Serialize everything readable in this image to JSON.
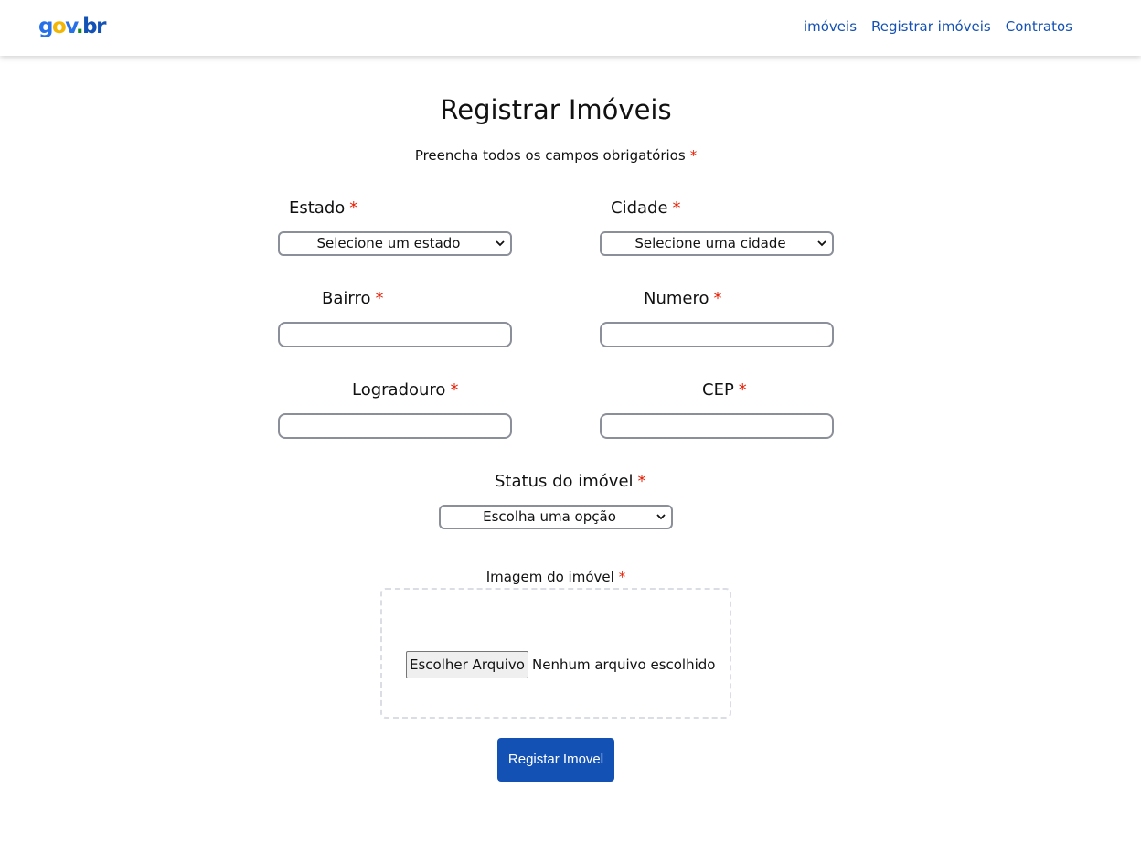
{
  "header": {
    "logo": {
      "g": "g",
      "o": "o",
      "v": "v",
      "dot": ".",
      "br": "br"
    },
    "nav": [
      {
        "label": "imóveis"
      },
      {
        "label": "Registrar imóveis"
      },
      {
        "label": "Contratos"
      }
    ]
  },
  "form": {
    "title": "Registrar Imóveis",
    "subtitle": "Preencha todos os campos obrigatórios",
    "required_mark": "*",
    "estado": {
      "label": "Estado",
      "selected": "Selecione um estado"
    },
    "cidade": {
      "label": "Cidade",
      "selected": "Selecione uma cidade"
    },
    "bairro": {
      "label": "Bairro",
      "value": ""
    },
    "numero": {
      "label": "Numero",
      "value": ""
    },
    "logradouro": {
      "label": "Logradouro",
      "value": ""
    },
    "cep": {
      "label": "CEP",
      "value": ""
    },
    "status": {
      "label": "Status do imóvel",
      "selected": "Escolha uma opção"
    },
    "imagem": {
      "label": "Imagem do imóvel",
      "button_label": "Escolher Arquivo",
      "status_text": "Nenhum arquivo escolhido"
    },
    "submit_label": "Registar Imovel"
  },
  "colors": {
    "brand_blue": "#1351b4",
    "required_red": "#e52207"
  }
}
